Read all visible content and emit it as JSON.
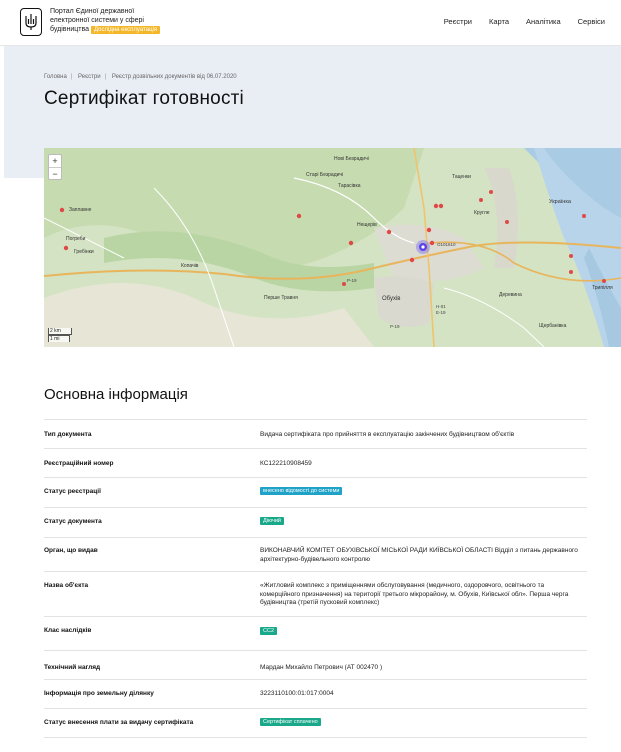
{
  "header": {
    "portal_line1": "Портал Єдиної державної",
    "portal_line2": "електронної системи у сфері",
    "portal_line3": "будівництва",
    "beta_label": "Дослідна експлуатація",
    "nav": [
      "Реєстри",
      "Карта",
      "Аналітика",
      "Сервіси"
    ]
  },
  "breadcrumbs": [
    "Головна",
    "Реєстри",
    "Реєстр дозвільних документів від 06.07.2020"
  ],
  "page_title": "Сертифікат готовності",
  "map": {
    "zoom_in": "+",
    "zoom_out": "−",
    "scale_km": "2 km",
    "scale_mi": "1 mi",
    "labels": [
      "Нові Безрадичі",
      "Старі Безрадичі",
      "Таценки",
      "Тарасівка",
      "Нещерів",
      "Заплавне",
      "Погреби",
      "Гребінки",
      "Копачів",
      "Перше Травня",
      "Обухів",
      "Українка",
      "Деревина",
      "Трипілля",
      "Щербанівка",
      "Кругле"
    ],
    "road_labels": [
      "P-19",
      "O101610",
      "H-01",
      "E-19",
      "P-19"
    ]
  },
  "section_title": "Основна інформація",
  "rows": [
    {
      "label": "Тип документа",
      "value": "Видача сертифіката про прийняття в експлуатацію закінчених будівництвом об'єктів",
      "badge": null
    },
    {
      "label": "Реєстраційний номер",
      "value": "КС122210908459",
      "badge": null
    },
    {
      "label": "Статус реєстрації",
      "value": "внесено відомості до системи",
      "badge": "blue"
    },
    {
      "label": "Статус документа",
      "value": "Діючий",
      "badge": "green"
    },
    {
      "label": "Орган, що видав",
      "value": "ВИКОНАВЧИЙ КОМІТЕТ ОБУХІВСЬКОЇ МІСЬКОЇ РАДИ КИЇВСЬКОЇ ОБЛАСТІ Відділ з питань державного архітектурно-будівельного контролю",
      "badge": null
    },
    {
      "label": "Назва об'єкта",
      "value": "«Житловий комплекс з приміщеннями обслуговування (медичного, оздоровчого, освітнього та комерційного призначення) на території третього мікрорайону, м. Обухів, Київської обл». Перша черга будівництва (третій пусковий комплекс)",
      "badge": null
    },
    {
      "label": "Клас наслідків",
      "value": "СС2",
      "badge": "green"
    },
    {
      "label": "Технічний нагляд",
      "value": "Мардан Михайло Петрович (АТ 002470 )",
      "badge": null
    },
    {
      "label": "Інформація про земельну ділянку",
      "value": "3223110100:01:017:0004",
      "badge": null
    },
    {
      "label": "Статус внесення плати за видачу сертифіката",
      "value": "Сертифікат сплачено",
      "badge": "green"
    }
  ]
}
